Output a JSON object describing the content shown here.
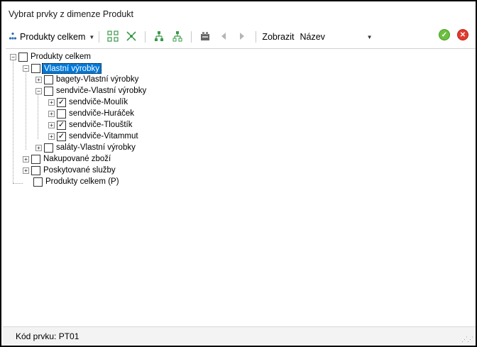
{
  "window": {
    "title": "Vybrat prvky z dimenze Produkt"
  },
  "toolbar": {
    "dimension_dropdown": {
      "label": "Produkty celkem"
    },
    "show_label": "Zobrazit",
    "show_select": {
      "value": "Název"
    },
    "icons": [
      "hierarchy-icon",
      "expand-all-icon",
      "collapse-all-icon",
      "select-children-icon",
      "select-descendants-icon",
      "filter-icon",
      "prev-icon",
      "next-icon",
      "ok-icon",
      "cancel-icon"
    ]
  },
  "tree": {
    "nodes": [
      {
        "label": "Produkty celkem",
        "expander": "−",
        "checked": false,
        "selected": false
      },
      {
        "label": "Vlastní výrobky",
        "expander": "−",
        "checked": false,
        "selected": true
      },
      {
        "label": "bagety-Vlastní výrobky",
        "expander": "+",
        "checked": false,
        "selected": false
      },
      {
        "label": "sendviče-Vlastní výrobky",
        "expander": "−",
        "checked": false,
        "selected": false
      },
      {
        "label": "sendviče-Moulík",
        "expander": "+",
        "checked": true,
        "selected": false
      },
      {
        "label": "sendviče-Huráček",
        "expander": "+",
        "checked": false,
        "selected": false
      },
      {
        "label": "sendviče-Tlouštík",
        "expander": "+",
        "checked": true,
        "selected": false
      },
      {
        "label": "sendviče-Vitammut",
        "expander": "+",
        "checked": true,
        "selected": false
      },
      {
        "label": "saláty-Vlastní výrobky",
        "expander": "+",
        "checked": false,
        "selected": false
      },
      {
        "label": "Nakupované zboží",
        "expander": "+",
        "checked": false,
        "selected": false
      },
      {
        "label": "Poskytované služby",
        "expander": "+",
        "checked": false,
        "selected": false
      },
      {
        "label": "Produkty celkem (P)",
        "expander": "",
        "checked": false,
        "selected": false
      }
    ]
  },
  "status": {
    "text": "Kód prvku: PT01"
  },
  "colors": {
    "selection": "#0078d7",
    "ok": "#6cbf3f",
    "cancel": "#e23b2e",
    "icon_green": "#3a9a4a"
  }
}
